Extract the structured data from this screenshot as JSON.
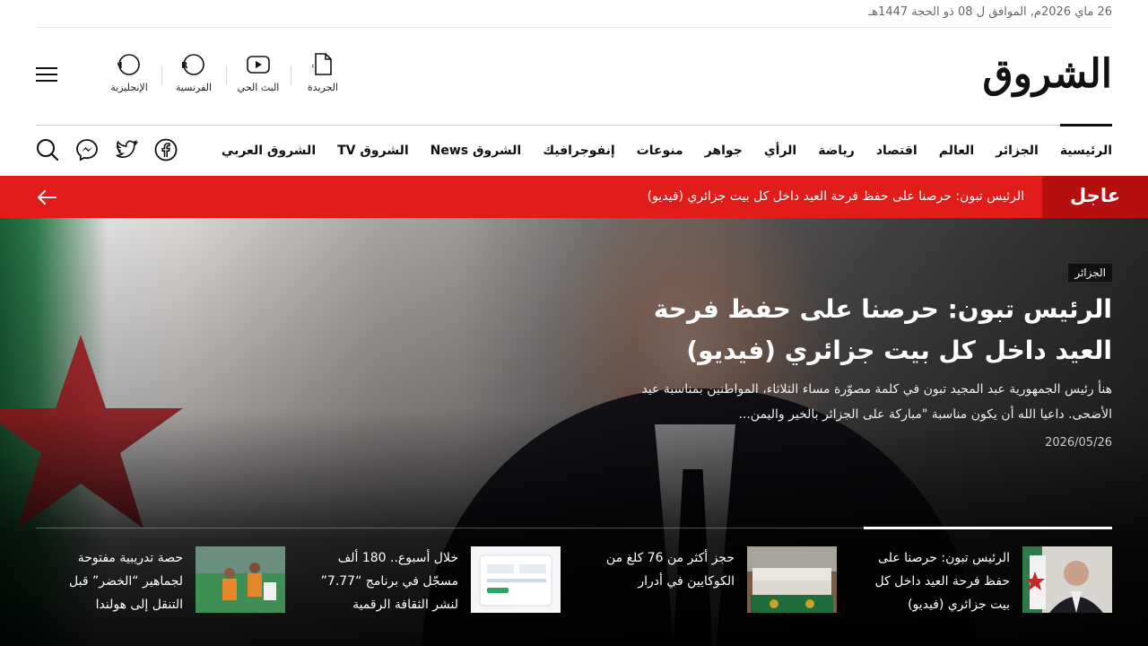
{
  "date_line": "26 ماي 2026م, الموافق ل 08 ذو الحجة 1447هـ",
  "brand": {
    "logo_text": "الشروق"
  },
  "shortcuts": [
    {
      "label": "الجريدة",
      "icon": "pdf-icon",
      "badge": "PDF"
    },
    {
      "label": "البث الحي",
      "icon": "youtube-play-icon"
    },
    {
      "label": "الفرنسية",
      "icon": "french-language-icon",
      "badge": "FR"
    },
    {
      "label": "الإنجليزية",
      "icon": "english-language-icon",
      "badge": "EN"
    }
  ],
  "nav": {
    "items": [
      "الرئيسية",
      "الجزائر",
      "العالم",
      "اقتصاد",
      "رياضة",
      "الرأي",
      "جواهر",
      "منوعات",
      "إنفوجرافيك",
      "الشروق News",
      "الشروق TV",
      "الشروق العربي"
    ],
    "active_index": 0,
    "icons": [
      "facebook-icon",
      "twitter-icon",
      "messenger-icon",
      "search-icon"
    ]
  },
  "breaking": {
    "label": "عاجل",
    "text": "الرئيس تبون: حرصنا على حفظ فرحة العيد داخل كل بيت جزائري (فيديو)",
    "color": "#e21b1b",
    "label_color": "#b50f0f"
  },
  "hero": {
    "category": "الجزائر",
    "title": "الرئيس تبون: حرصنا على حفظ فرحة العيد داخل كل بيت جزائري (فيديو)",
    "excerpt": "هنأ رئيس الجمهورية عبد المجيد تبون في كلمة مصوّرة مساء الثلاثاء، المواطنين بمناسبة عيد الأضحى. داعيا الله أن يكون مناسبة \"مباركة على الجزائر بالخير واليمن...",
    "date": "2026/05/26"
  },
  "cards": [
    {
      "title": "الرئيس تبون: حرصنا على حفظ فرحة العيد داخل كل بيت جزائري (فيديو)",
      "thumb": "president-video-thumbnail"
    },
    {
      "title": "حجز أكثر من 76 كلغ من الكوكايين في أدرار",
      "thumb": "seized-drugs-thumbnail"
    },
    {
      "title": "خلال أسبوع.. 180 ألف مسجّل في برنامج “7.77” لنشر الثقافة الرقمية",
      "thumb": "digital-program-thumbnail"
    },
    {
      "title": "حصة تدريبية مفتوحة لجماهير “الخضر” قبل التنقل إلى هولندا",
      "thumb": "football-training-thumbnail"
    }
  ]
}
